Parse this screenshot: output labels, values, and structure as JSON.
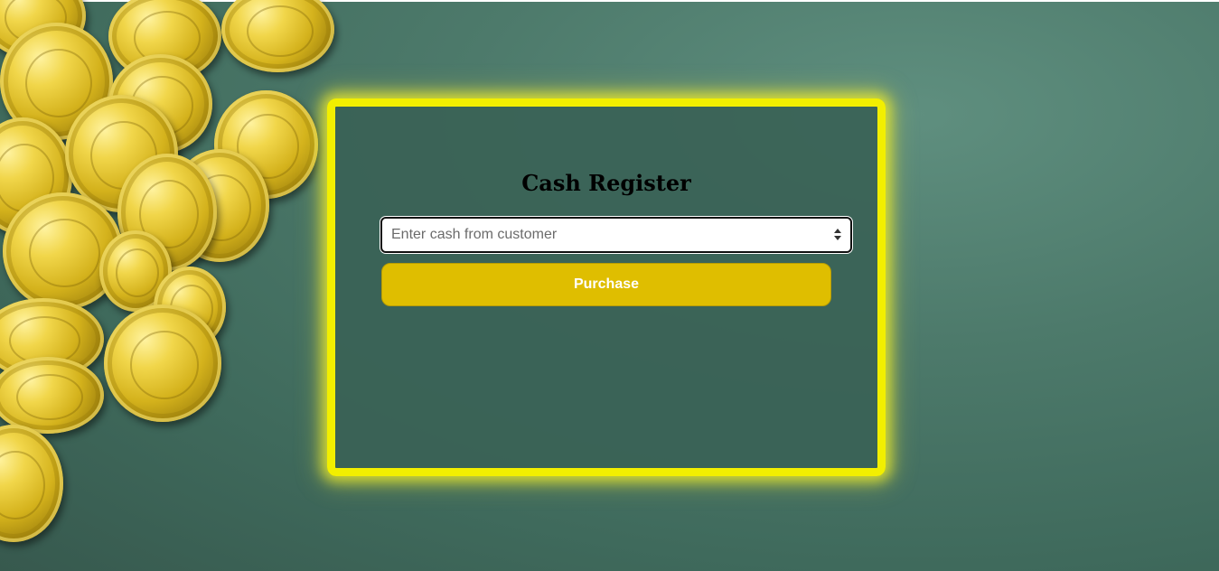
{
  "page": {
    "title": "Cash Register"
  },
  "cash_input": {
    "value": "",
    "placeholder": "Enter cash from customer"
  },
  "purchase_button": {
    "label": "Purchase"
  },
  "colors": {
    "panel_border": "#f2ef00",
    "button_background": "#dfbe00",
    "background": "#4d7a6b"
  },
  "icons": {
    "spinner": "number-spinner-icon",
    "coins": "gold-coins-decoration"
  }
}
